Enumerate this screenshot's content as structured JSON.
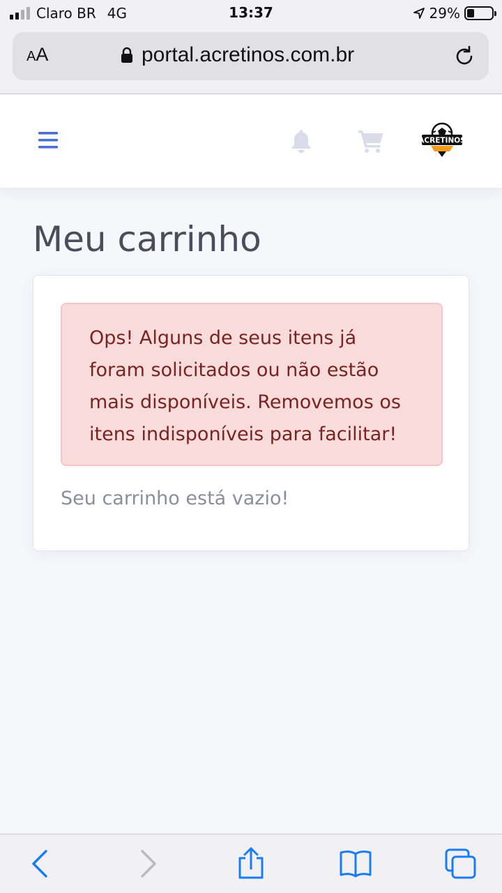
{
  "status_bar": {
    "carrier": "Claro BR",
    "network": "4G",
    "time": "13:37",
    "battery_percent": "29%",
    "battery_level": 0.29
  },
  "browser": {
    "text_size_button_small": "A",
    "text_size_button_large": "A",
    "url": "portal.acretinos.com.br"
  },
  "header": {
    "logo_text": "ACRETINOS"
  },
  "main": {
    "title": "Meu carrinho",
    "alert_message": "Ops! Alguns de seus itens já foram solicitados ou não estão mais disponíveis. Removemos os itens indisponíveis para facilitar!",
    "empty_cart_message": "Seu carrinho está vazio!"
  },
  "toolbar": {
    "items": [
      "back-icon",
      "forward-icon",
      "share-icon",
      "bookmarks-icon",
      "tabs-icon"
    ]
  },
  "colors": {
    "accent_blue": "#4a6fd1",
    "alert_background": "#f8dcdc",
    "alert_text": "#7a2320",
    "ios_blue": "#1a7cf5"
  }
}
